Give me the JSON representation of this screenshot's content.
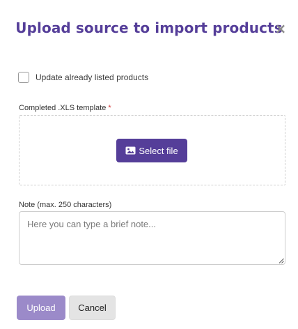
{
  "dialog": {
    "title": "Upload source to import products",
    "close_symbol": "×"
  },
  "update_checkbox": {
    "label": "Update already listed products",
    "checked": false
  },
  "template_field": {
    "label": "Completed .XLS template",
    "required_mark": "*",
    "select_button_label": "Select file",
    "select_button_icon": "image-icon"
  },
  "note_field": {
    "label": "Note (max. 250 characters)",
    "placeholder": "Here you can type a brief note...",
    "value": ""
  },
  "actions": {
    "upload_label": "Upload",
    "cancel_label": "Cancel"
  },
  "colors": {
    "primary": "#553e99",
    "primary_disabled": "#9b8ac9",
    "required": "#d43b3b"
  }
}
